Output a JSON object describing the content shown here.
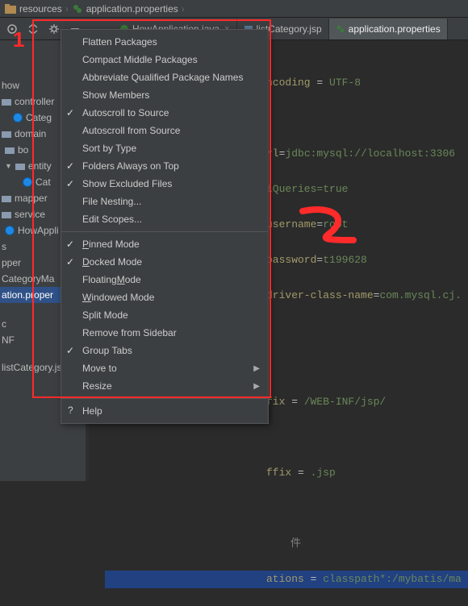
{
  "breadcrumb": {
    "item1": "resources",
    "item2": "application.properties"
  },
  "tabs": {
    "t1": "HowApplication.java",
    "t2": "listCategory.jsp",
    "t3": "application.properties"
  },
  "tree": {
    "how": "how",
    "controller": "controller",
    "categ1": "Categ",
    "domain": "domain",
    "bo": "bo",
    "entity": "entity",
    "cat": "Cat",
    "mapper": "mapper",
    "service": "service",
    "howAppl": "HowAppli",
    "s": "s",
    "pper": "pper",
    "categoryMa": "CategoryMa",
    "appProps": "ation.proper",
    "c": "c",
    "nf": "NF",
    "listCategory": "listCategory.jsp"
  },
  "menu": {
    "flatten": "Flatten Packages",
    "compact": "Compact Middle Packages",
    "abbrev": "Abbreviate Qualified Package Names",
    "members": "Show Members",
    "autoTo": "Autoscroll to Source",
    "autoFrom": "Autoscroll from Source",
    "sortType": "Sort by Type",
    "foldersTop": "Folders Always on Top",
    "showExcl": "Show Excluded Files",
    "fileNest": "File Nesting...",
    "editScopes": "Edit Scopes...",
    "pinned_pre": "",
    "pinned_u": "P",
    "pinned_post": "inned Mode",
    "docked_pre": "",
    "docked_u": "D",
    "docked_post": "ocked Mode",
    "floating_pre": "Floating ",
    "floating_u": "M",
    "floating_post": "ode",
    "windowed_pre": "",
    "windowed_u": "W",
    "windowed_post": "indowed Mode",
    "split": "Split Mode",
    "remove": "Remove from Sidebar",
    "group": "Group Tabs",
    "moveTo": "Move to",
    "resize": "Resize",
    "help": "Help"
  },
  "editor": {
    "l1a": "ncoding",
    "l1b": " = ",
    "l1c": "UTF-8",
    "l2a": "rl",
    "l2b": "=",
    "l2c": "jdbc:mysql://localhost:3306",
    "l3a": "iQueries=true",
    "l4a": "username",
    "l4b": "=",
    "l4c": "root",
    "l5a": "password",
    "l5b": "=",
    "l5c": "t199628",
    "l6a": "driver-class-name",
    "l6b": "=",
    "l6c": "com.mysql.cj.",
    "l7a": "fix",
    "l7b": " = ",
    "l7c": "/WEB-INF/jsp/",
    "l8a": "ffix",
    "l8b": " = ",
    "l8c": ".jsp",
    "l9pre": "件",
    "l10a": "ations",
    "l10b": " = ",
    "l10c": "classpath*:/mybatis/ma"
  },
  "anno": {
    "one": "1"
  }
}
